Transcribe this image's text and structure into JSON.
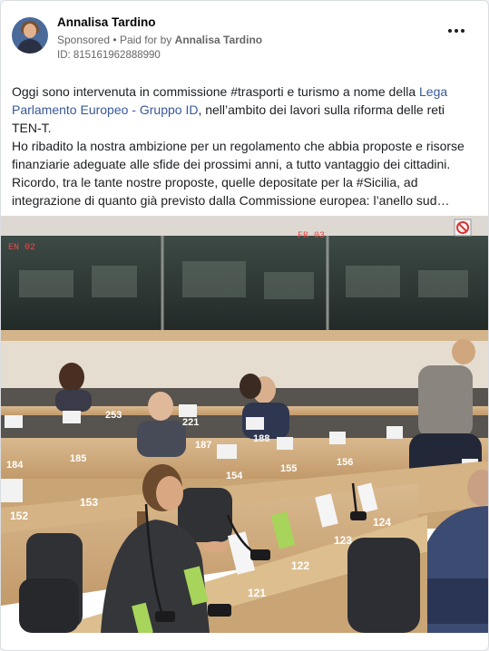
{
  "post": {
    "author": "Annalisa Tardino",
    "sponsored": "Sponsored",
    "paid_for_prefix": "Paid for by",
    "paid_for_by": "Annalisa Tardino",
    "ad_id": "ID: 815161962888990",
    "text": {
      "p1_a": "Oggi sono intervenuta in commissione #trasporti e turismo a nome della ",
      "p1_link": "Lega Parlamento Europeo - Gruppo ID",
      "p1_b": ", nell’ambito dei lavori sulla riforma delle reti TEN-T.",
      "p2": "Ho ribadito la nostra ambizione per un regolamento che abbia proposte e risorse finanziarie adeguate alle sfide dei prossimi anni, a tutto vantaggio dei cittadini.",
      "p3": "Ricordo, tra le tante nostre proposte, quelle depositate per la #Sicilia, ad integrazione di quanto già previsto dalla Commissione europea: l’anello sud…"
    }
  },
  "photo": {
    "booth_labels": [
      "EN 02",
      "FR 03"
    ],
    "seat_numbers": [
      "253",
      "221",
      "187",
      "188",
      "185",
      "184",
      "154",
      "155",
      "156",
      "153",
      "152",
      "122",
      "123",
      "124",
      "121"
    ]
  },
  "icons": {
    "avatar": "profile-photo",
    "menu": "more-horizontal-icon",
    "no_entry": "prohibition-sign-icon"
  },
  "colors": {
    "link": "#385898",
    "meta": "#65676b"
  }
}
